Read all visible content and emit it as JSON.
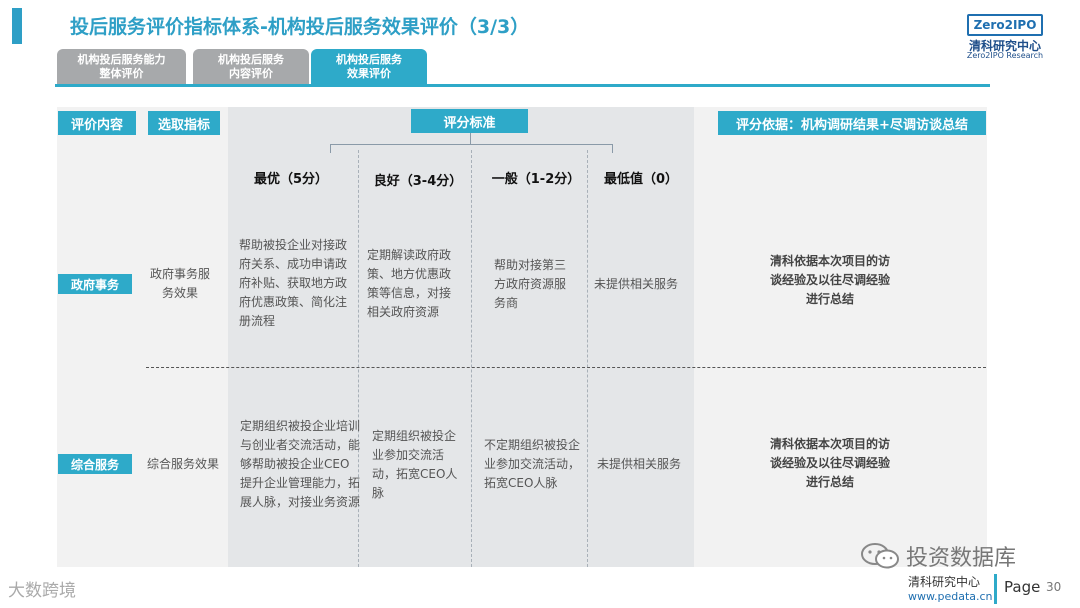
{
  "header": {
    "title": "投后服务评价指标体系-机构投后服务效果评价（3/3）",
    "logo_text": "Zero2IPO",
    "logo_cn": "清科研究中心",
    "logo_en": "Zero2IPO Research"
  },
  "tabs": [
    {
      "line1": "机构投后服务能力",
      "line2": "整体评价",
      "active": false
    },
    {
      "line1": "机构投后服务",
      "line2": "内容评价",
      "active": false
    },
    {
      "line1": "机构投后服务",
      "line2": "效果评价",
      "active": true
    }
  ],
  "table": {
    "col_content": "评价内容",
    "col_indicator": "选取指标",
    "col_criteria": "评分标准",
    "col_basis": "评分依据：机构调研结果+尽调访谈总结",
    "levels": [
      "最优（5分）",
      "良好（3-4分）",
      "一般（1-2分）",
      "最低值（0）"
    ],
    "rows": [
      {
        "category": "政府事务",
        "indicator": "政府事务服务效果",
        "criteria": [
          "帮助被投企业对接政府关系、成功申请政府补贴、获取地方政府优惠政策、简化注册流程",
          "定期解读政府政策、地方优惠政策等信息，对接相关政府资源",
          "帮助对接第三方政府资源服务商",
          "未提供相关服务"
        ],
        "basis": "清科依据本次项目的访谈经验及以往尽调经验进行总结"
      },
      {
        "category": "综合服务",
        "indicator": "综合服务效果",
        "criteria": [
          "定期组织被投企业培训与创业者交流活动，能够帮助被投企业CEO提升企业管理能力，拓展人脉，对接业务资源",
          "定期组织被投企业参加交流活动，拓宽CEO人脉",
          "不定期组织被投企业参加交流活动，拓宽CEO人脉",
          "未提供相关服务"
        ],
        "basis": "清科依据本次项目的访谈经验及以往尽调经验进行总结"
      }
    ]
  },
  "footer": {
    "left_watermark": "大数跨境",
    "right_watermark": "投资数据库",
    "org": "清科研究中心",
    "url": "www.pedata.cn",
    "page_label": "Page",
    "page_number": "30"
  },
  "colors": {
    "accent": "#2eaac9",
    "tab_inactive": "#a7a9ab",
    "title": "#2e9fc6"
  }
}
